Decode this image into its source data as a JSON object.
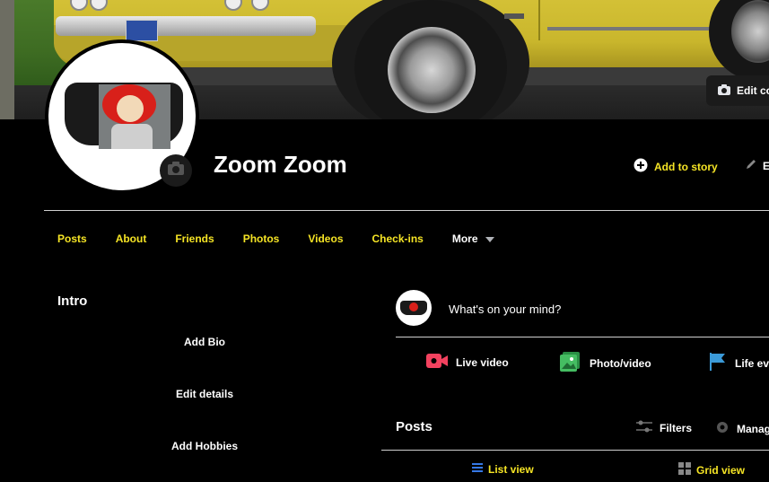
{
  "cover": {
    "edit_cover_label": "Edit co"
  },
  "profile": {
    "name": "Zoom Zoom"
  },
  "header_actions": {
    "add_story": "Add to story",
    "edit_profile": "E"
  },
  "tabs": [
    {
      "label": "Posts"
    },
    {
      "label": "About"
    },
    {
      "label": "Friends"
    },
    {
      "label": "Photos"
    },
    {
      "label": "Videos"
    },
    {
      "label": "Check-ins"
    },
    {
      "label": "More"
    }
  ],
  "intro": {
    "title": "Intro",
    "add_bio": "Add Bio",
    "edit_details": "Edit details",
    "add_hobbies": "Add Hobbies"
  },
  "composer": {
    "prompt": "What's on your mind?",
    "actions": [
      {
        "label": "Live video",
        "icon": "live-video-icon",
        "color": "#f3425f"
      },
      {
        "label": "Photo/video",
        "icon": "photo-video-icon",
        "color": "#45bd62"
      },
      {
        "label": "Life eve",
        "icon": "life-event-icon",
        "color": "#1877f2"
      }
    ]
  },
  "posts": {
    "title": "Posts",
    "filters": "Filters",
    "manage": "Manag",
    "list_view": "List view",
    "grid_view": "Grid view"
  },
  "colors": {
    "accent": "#f5e425",
    "background": "#000000"
  }
}
